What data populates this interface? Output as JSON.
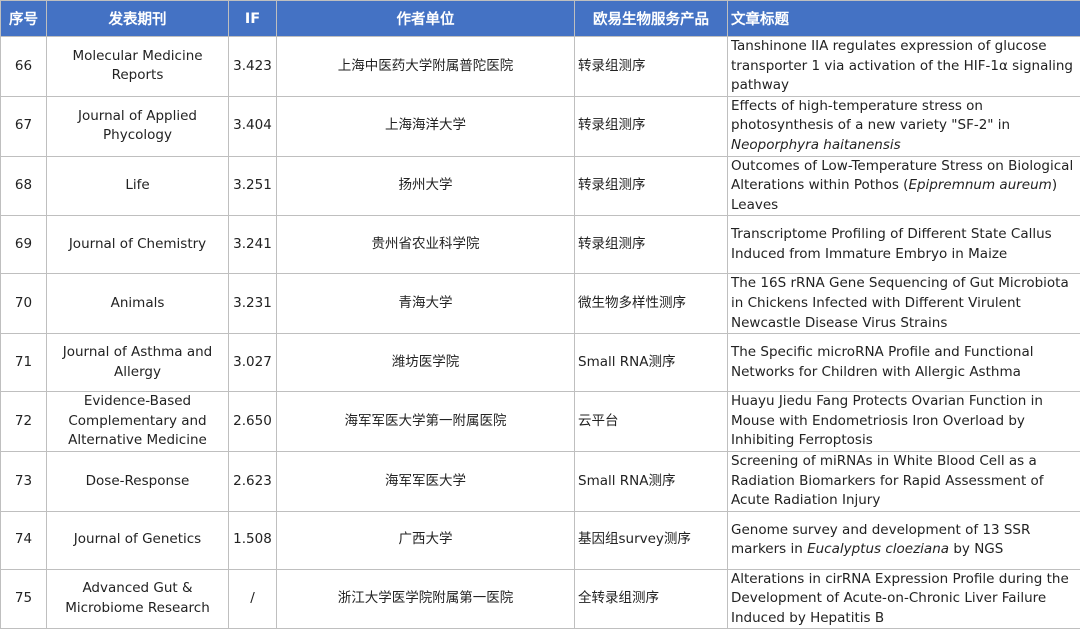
{
  "header": {
    "no": "序号",
    "journal": "发表期刊",
    "if": "IF",
    "institution": "作者单位",
    "service": "欧易生物服务产品",
    "title": "文章标题"
  },
  "rows": [
    {
      "no": "66",
      "journal": "Molecular Medicine Reports",
      "if": "3.423",
      "institution": "上海中医药大学附属普陀医院",
      "service": "转录组测序",
      "title": "Tanshinone IIA regulates expression of glucose transporter 1 via activation of the HIF-1α signaling pathway"
    },
    {
      "no": "67",
      "journal": "Journal of Applied Phycology",
      "if": "3.404",
      "institution": "上海海洋大学",
      "service": "转录组测序",
      "title_pre": "Effects of high-temperature stress on photosynthesis of a new variety \"SF-2\" in ",
      "title_em": "Neoporphyra haitanensis",
      "title_post": ""
    },
    {
      "no": "68",
      "journal": "Life",
      "if": "3.251",
      "institution": "扬州大学",
      "service": "转录组测序",
      "title_pre": "Outcomes of Low-Temperature Stress on Biological Alterations within Pothos (",
      "title_em": "Epipremnum aureum",
      "title_post": ") Leaves"
    },
    {
      "no": "69",
      "journal": "Journal of Chemistry",
      "if": "3.241",
      "institution": "贵州省农业科学院",
      "service": "转录组测序",
      "title": "Transcriptome Profiling of Different State Callus Induced from Immature Embryo in Maize"
    },
    {
      "no": "70",
      "journal": "Animals",
      "if": "3.231",
      "institution": "青海大学",
      "service": "微生物多样性测序",
      "title": "The 16S rRNA Gene Sequencing of Gut Microbiota in Chickens Infected with Different Virulent Newcastle Disease Virus Strains"
    },
    {
      "no": "71",
      "journal": "Journal of Asthma and Allergy",
      "if": "3.027",
      "institution": "潍坊医学院",
      "service": "Small RNA测序",
      "title": "The Specific microRNA Profile and Functional Networks for Children with Allergic Asthma"
    },
    {
      "no": "72",
      "journal": "Evidence-Based Complementary and Alternative Medicine",
      "if": "2.650",
      "institution": "海军军医大学第一附属医院",
      "service": "云平台",
      "title": "Huayu Jiedu Fang Protects Ovarian Function in Mouse with Endometriosis Iron Overload by Inhibiting Ferroptosis"
    },
    {
      "no": "73",
      "journal": "Dose-Response",
      "if": "2.623",
      "institution": "海军军医大学",
      "service": "Small RNA测序",
      "title": "Screening of miRNAs in White Blood Cell as a Radiation Biomarkers for Rapid Assessment of Acute Radiation Injury"
    },
    {
      "no": "74",
      "journal": "Journal of Genetics",
      "if": "1.508",
      "institution": "广西大学",
      "service": "基因组survey测序",
      "title_pre": "Genome survey and development of 13 SSR markers in ",
      "title_em": "Eucalyptus cloeziana",
      "title_post": " by NGS"
    },
    {
      "no": "75",
      "journal": "Advanced Gut & Microbiome Research",
      "if": "/",
      "institution": "浙江大学医学院附属第一医院",
      "service": "全转录组测序",
      "title": "Alterations in cirRNA Expression Profile during the Development of Acute-on-Chronic Liver Failure Induced by Hepatitis B"
    }
  ]
}
